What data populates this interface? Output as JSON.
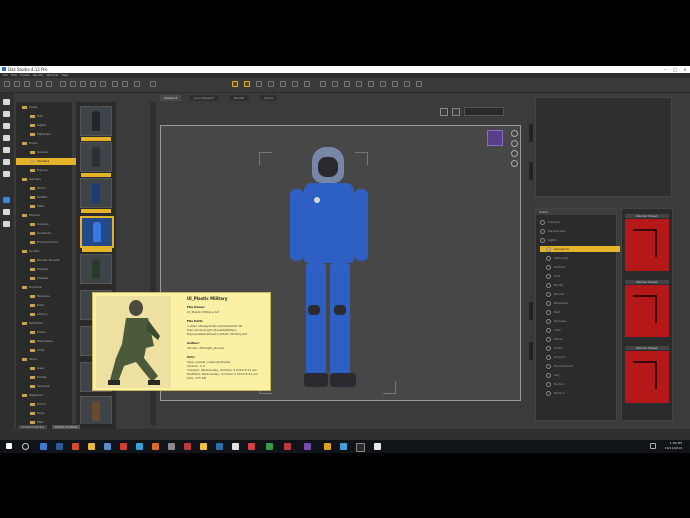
{
  "window": {
    "title": "Daz Studio 4.12 Pro"
  },
  "menu": [
    "File",
    "Edit",
    "Create",
    "Render",
    "Window",
    "Help"
  ],
  "content_library": {
    "tree_items": [
      "Props",
      "Hair",
      "Lights",
      "Materials",
      "Poses",
      "Scenes",
      "Shaders",
      "Figures",
      "Genesis",
      "Items",
      "Outfits",
      "Male",
      "Female",
      "Camera",
      "Aniblocks",
      "Environments",
      "Scripts",
      "Render Presets",
      "Utilities",
      "Presets",
      "Runtime",
      "Textures",
      "Data",
      "Library",
      "Modifiers",
      "Poses",
      "Wearables",
      "Units",
      "Skins",
      "Gear",
      "Extras",
      "Vehicles",
      "Weapons",
      "Decor",
      "Tools",
      "Misc"
    ],
    "selected_index": 6,
    "tabs": [
      "Content Library",
      "Smart Content"
    ]
  },
  "viewport": {
    "tabs": [
      "Viewport",
      "Aux Viewport",
      "Render",
      "Scene"
    ]
  },
  "tooltip": {
    "title": "UI_Plastic Military",
    "sections": [
      {
        "heading": "File Name:",
        "lines": [
          "UI_Plastic Military.duf"
        ]
      },
      {
        "heading": "File Path:",
        "lines": [
          "C:/Daz 3D/Applications/Data/DAZ 3D",
          "Daz Library/Light Presets/Military",
          "Figures/Wearables/UI_Plastic Military.duf"
        ]
      },
      {
        "heading": "Author:",
        "lines": [
          "Vendor: Midnight_stories"
        ]
      },
      {
        "heading": "Info:",
        "lines": [
          "Type:        preset_material/shader",
          "Version:    1.0",
          "Created:    Wednesday, October 9 2019 8:21 am",
          "Modified:   Wednesday, October 9 2019 8:21 am",
          "Size:         375 KB"
        ]
      }
    ]
  },
  "scene": {
    "header": "Scene",
    "items": [
      "Camera",
      "Perspective",
      "Lights",
      "Genesis 8",
      "Astronaut",
      "Helmet",
      "Suit",
      "Boots",
      "Gloves",
      "Backpack",
      "Belt",
      "Harness",
      "Visor",
      "Tubes",
      "Props",
      "Ground",
      "Environment",
      "Sky",
      "Node 1",
      "Node 2"
    ],
    "selected_index": 3
  },
  "smart_content": {
    "cards": [
      "Render Preset",
      "Render Preset",
      "Render Preset"
    ]
  },
  "taskbar": {
    "time": "1:06 PM",
    "date": "10/11/2019"
  },
  "colors": {
    "accent": "#e5b32a",
    "suit": "#2e5fc4",
    "tooltip": "#fbf1a4",
    "card": "#b51818"
  }
}
